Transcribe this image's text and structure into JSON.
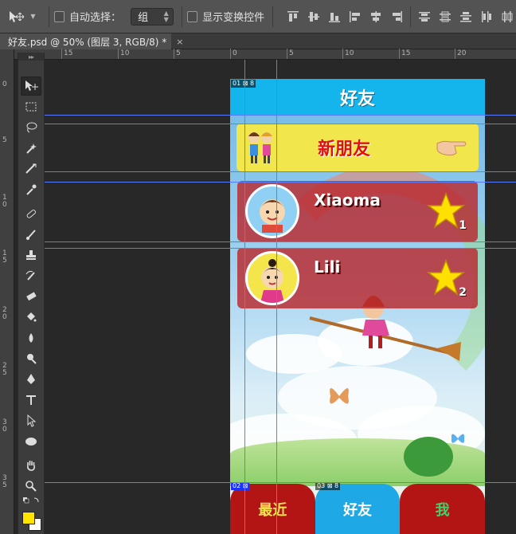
{
  "options_bar": {
    "auto_select_label": "自动选择：",
    "auto_select_value": "组",
    "show_transform_label": "显示变换控件"
  },
  "document": {
    "tab_title": "好友.psd @ 50% (图层 3, RGB/8) *",
    "close": "×"
  },
  "ruler": {
    "h_labels": [
      "15",
      "10",
      "5",
      "0",
      "5",
      "10",
      "15",
      "20"
    ],
    "v_labels": [
      "0",
      "5",
      "10",
      "15",
      "20",
      "25",
      "30",
      "35"
    ]
  },
  "app": {
    "title": "好友",
    "new_friend_label": "新朋友",
    "friends": [
      {
        "name": "Xiaoma",
        "rank": "1"
      },
      {
        "name": "Lili",
        "rank": "2"
      }
    ],
    "nav": [
      "最近",
      "好友",
      "我"
    ]
  },
  "slices": {
    "s1": "01",
    "s2": "02",
    "s3": "03",
    "s1_num": "8",
    "s3_num": "8"
  },
  "colors": {
    "foreground": "#ffe400",
    "background": "#ffffff"
  }
}
